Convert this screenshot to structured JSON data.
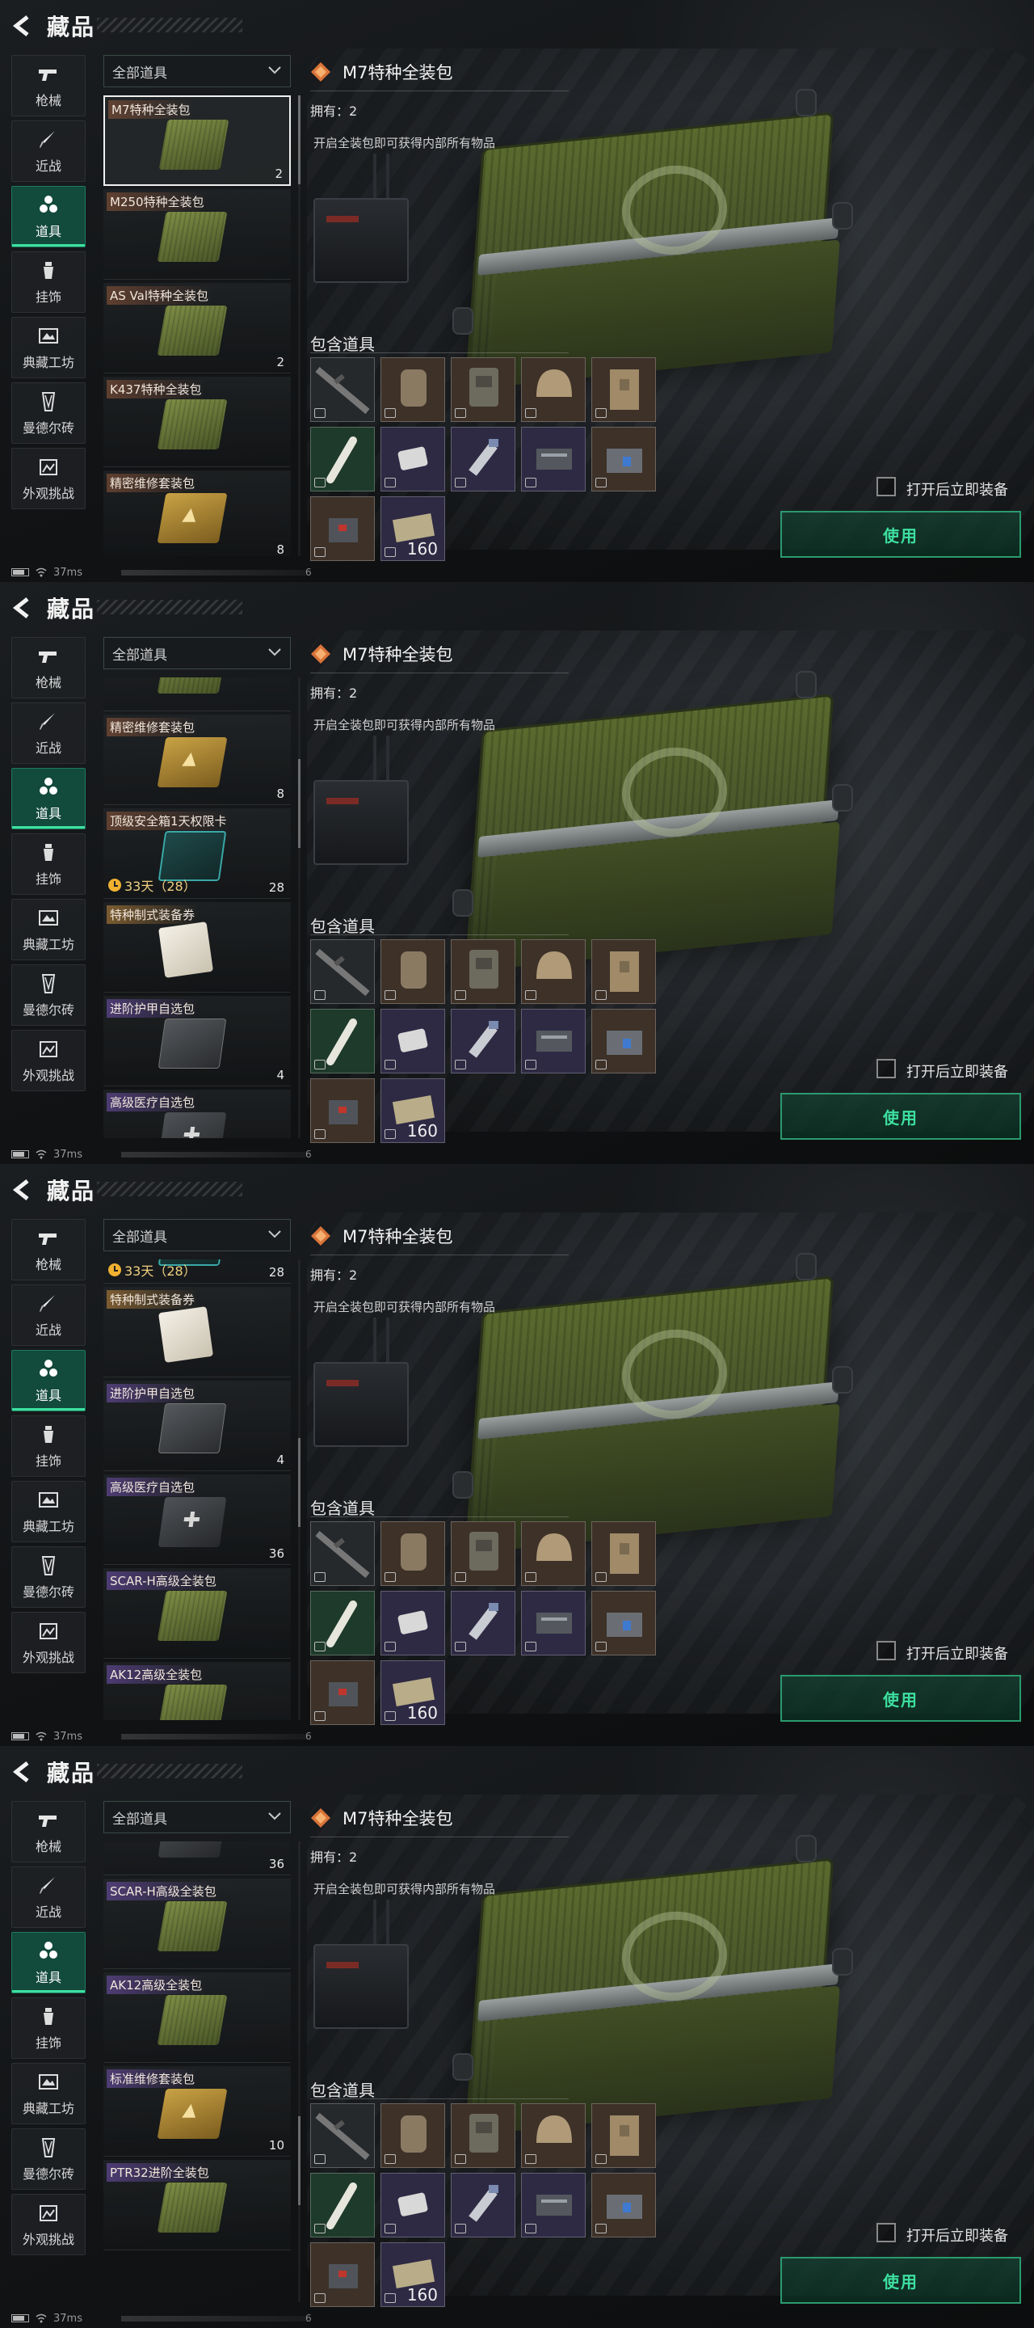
{
  "header": {
    "title": "藏品"
  },
  "sidebar": {
    "items": [
      {
        "label": "枪械",
        "icon": "gun-icon",
        "active": false
      },
      {
        "label": "近战",
        "icon": "knife-icon",
        "active": false
      },
      {
        "label": "道具",
        "icon": "items-icon",
        "active": true
      },
      {
        "label": "挂饰",
        "icon": "charm-icon",
        "active": false
      },
      {
        "label": "典藏工坊",
        "icon": "workshop-icon",
        "active": false
      },
      {
        "label": "曼德尔砖",
        "icon": "brick-icon",
        "active": false
      },
      {
        "label": "外观挑战",
        "icon": "challenge-icon",
        "active": false
      }
    ]
  },
  "filter": {
    "label": "全部道具"
  },
  "items": [
    {
      "name": "M7特种全装包",
      "count": "2",
      "style": "crate-g",
      "tag": "normal",
      "selected": true
    },
    {
      "name": "M250特种全装包",
      "count": "",
      "style": "crate-g",
      "tag": "normal"
    },
    {
      "name": "AS Val特种全装包",
      "count": "2",
      "style": "crate-g",
      "tag": "normal"
    },
    {
      "name": "K437特种全装包",
      "count": "",
      "style": "crate-g",
      "tag": "normal"
    },
    {
      "name": "精密维修套装包",
      "count": "8",
      "style": "crate-y",
      "tag": "normal"
    },
    {
      "name": "顶级安全箱1天权限卡",
      "count": "28",
      "timer": "33天（28）",
      "style": "card",
      "tag": "normal"
    },
    {
      "name": "特种制式装备券",
      "count": "",
      "style": "paper",
      "tag": "gold"
    },
    {
      "name": "进阶护甲自选包",
      "count": "4",
      "style": "dark",
      "tag": "purple"
    },
    {
      "name": "高级医疗自选包",
      "count": "36",
      "style": "dark-med",
      "tag": "purple"
    },
    {
      "name": "SCAR-H高级全装包",
      "count": "",
      "style": "crate-g",
      "tag": "purple"
    },
    {
      "name": "AK12高级全装包",
      "count": "",
      "style": "crate-g",
      "tag": "purple"
    },
    {
      "name": "标准维修套装包",
      "count": "10",
      "style": "crate-y",
      "tag": "purple"
    },
    {
      "name": "PTR32进阶全装包",
      "count": "",
      "style": "crate-g",
      "tag": "purple"
    }
  ],
  "detail": {
    "title": "M7特种全装包",
    "own_label": "拥有：",
    "own_count": "2",
    "description": "开启全装包即可获得内部所有物品",
    "contains_title": "包含道具",
    "contents": [
      {
        "name": "rifle-icon",
        "bg": "#26292c"
      },
      {
        "name": "backpack-icon",
        "bg": "#3d3128"
      },
      {
        "name": "chest-rig-icon",
        "bg": "#3d3128"
      },
      {
        "name": "helmet-icon",
        "bg": "#3d3128"
      },
      {
        "name": "armor-vest-icon",
        "bg": "#3d3128"
      },
      {
        "name": "injector-icon",
        "bg": "#1e3a2a"
      },
      {
        "name": "bandage-icon",
        "bg": "#2e2a44"
      },
      {
        "name": "syringe-icon",
        "bg": "#2e2a44"
      },
      {
        "name": "medkit-icon",
        "bg": "#2e2a44"
      },
      {
        "name": "repair-kit-icon",
        "bg": "#3d3128"
      },
      {
        "name": "grenade-box-icon",
        "bg": "#3d3128"
      },
      {
        "name": "ammo-box-icon",
        "bg": "#2e2a44",
        "qty": "160"
      }
    ]
  },
  "equip_label": "打开后立即装备",
  "use_label": "使用",
  "status": {
    "ping": "37ms",
    "six": "6"
  },
  "frames": [
    {
      "scroll_rows": 0,
      "scroll_extra": 0,
      "thumb": 0.0
    },
    {
      "scroll_rows": 3,
      "scroll_extra": 70,
      "thumb": 0.22
    },
    {
      "scroll_rows": 5,
      "scroll_extra": 82,
      "thumb": 0.48
    },
    {
      "scroll_rows": 8,
      "scroll_extra": 70,
      "thumb": 0.74
    }
  ],
  "colors": {
    "accent": "#3de0a0",
    "active_nav": "#124a3c"
  }
}
